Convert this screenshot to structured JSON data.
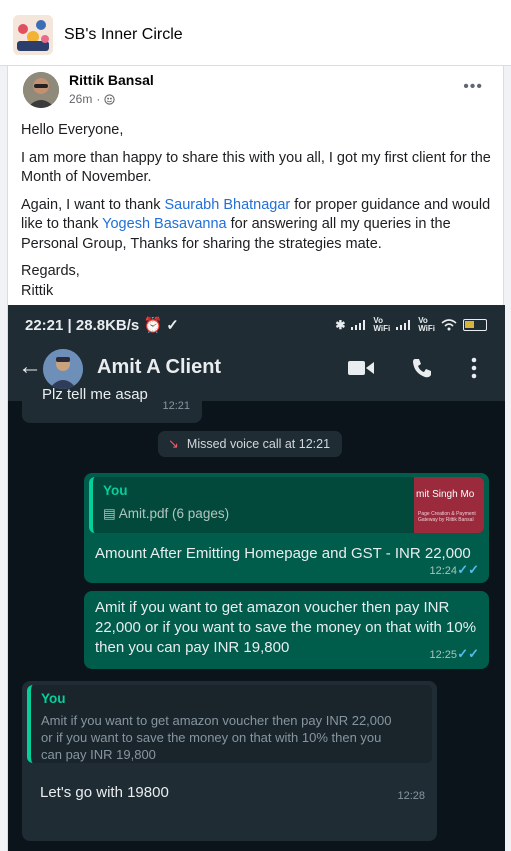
{
  "group": {
    "name": "SB's Inner Circle"
  },
  "post": {
    "author": "Rittik Bansal",
    "time": "26m",
    "more_label": "•••",
    "greeting": "Hello Everyone,",
    "para1": "I am more than happy to share this with you all, I got my first client for the Month of November.",
    "para2_pre": "Again, I want to thank ",
    "mention1": "Saurabh Bhatnagar",
    "para2_mid": " for proper guidance and would like to thank ",
    "mention2": "Yogesh Basavanna",
    "para2_post": " for answering all my queries in the Personal Group, Thanks for sharing the strategies mate.",
    "regards": "Regards,",
    "signoff": "Rittik"
  },
  "phone": {
    "status_time": "22:21 | 28.8KB/s",
    "status_icons": "✱ .❙❙ Vo WiFi .❙❙ Vo WiFi",
    "battery": "54",
    "contact_name": "Amit A Client",
    "partial_msg": "Plz tell me asap",
    "partial_time": "12:21",
    "missed_call": "Missed voice call at 12:21",
    "msg1": {
      "quote_who": "You",
      "quote_doc": "Amit.pdf (6 pages)",
      "thumb_title": "mit Singh Mo",
      "thumb_sub": "Page Creation & Payment Gateway by Rittik Bansal",
      "text": "Amount After Emitting Homepage and GST - INR 22,000",
      "time": "12:24"
    },
    "msg2": {
      "text": "Amit if you want to get amazon voucher then pay INR 22,000 or if you want to save the money on that with 10% then you can pay INR 19,800",
      "time": "12:25"
    },
    "msg3": {
      "quote_who": "You",
      "quote_text": "Amit if you want to get amazon voucher then pay INR 22,000 or if you want to save the money on that with 10% then you can pay INR 19,800",
      "text": "Let's go with 19800",
      "time": "12:28"
    },
    "colors": {
      "tick": "#53bdeb",
      "outgoing": "#005c4b",
      "incoming": "#1f2c34",
      "accent": "#06cf9c"
    }
  }
}
